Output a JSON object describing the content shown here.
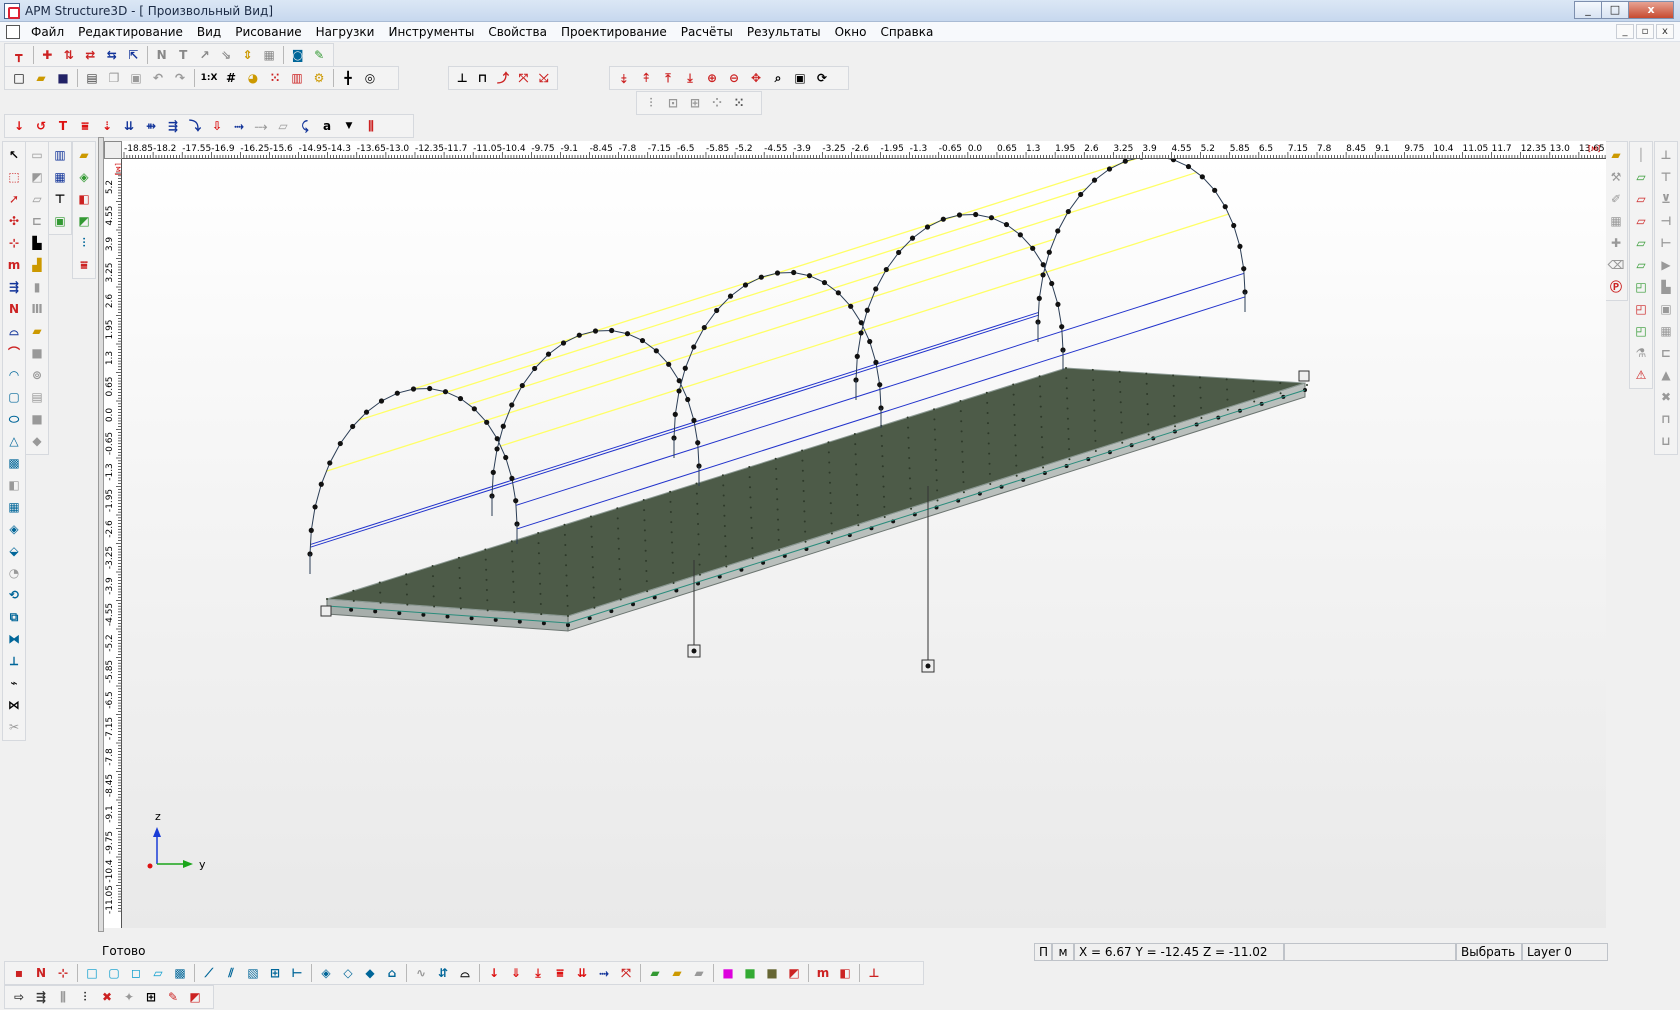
{
  "window": {
    "title": "APM Structure3D - [ Произвольный Вид]",
    "minimize_label": "_",
    "maximize_label": "□",
    "close_label": "x"
  },
  "menu": {
    "items": [
      "Файл",
      "Редактирование",
      "Вид",
      "Рисование",
      "Нагрузки",
      "Инструменты",
      "Свойства",
      "Проектирование",
      "Расчёты",
      "Результаты",
      "Окно",
      "Справка"
    ],
    "mdi_minimize": "_",
    "mdi_restore": "▫",
    "mdi_close": "x"
  },
  "rulers": {
    "horizontal_ticks": [
      "-18.85",
      "-18.2",
      "-17.55",
      "-16.9",
      "-16.25",
      "-15.6",
      "-14.95",
      "-14.3",
      "-13.65",
      "-13.0",
      "-12.35",
      "-11.7",
      "-11.05",
      "-10.4",
      "-9.75",
      "-9.1",
      "-8.45",
      "-7.8",
      "-7.15",
      "-6.5",
      "-5.85",
      "-5.2",
      "-4.55",
      "-3.9",
      "-3.25",
      "-2.6",
      "-1.95",
      "-1.3",
      "-0.65",
      "0.0",
      "0.65",
      "1.3",
      "1.95",
      "2.6",
      "3.25",
      "3.9",
      "4.55",
      "5.2",
      "5.85",
      "6.5",
      "7.15",
      "7.8",
      "8.45",
      "9.1",
      "9.75",
      "10.4",
      "11.05",
      "11.7",
      "12.35",
      "13.0",
      "13.65"
    ],
    "horizontal_unit": "[м]",
    "vertical_ticks": [
      "5.2",
      "4.55",
      "3.9",
      "3.25",
      "2.6",
      "1.95",
      "1.3",
      "0.65",
      "0.0",
      "-0.65",
      "-1.3",
      "-1.95",
      "-2.6",
      "-3.25",
      "-3.9",
      "-4.55",
      "-5.2",
      "-5.85",
      "-6.5",
      "-7.15",
      "-7.8",
      "-8.45",
      "-9.1",
      "-9.75",
      "-10.4",
      "-11.05"
    ],
    "vertical_unit": "[м]"
  },
  "axes": {
    "z": "z",
    "y": "y"
  },
  "status": {
    "ready": "Готово",
    "p": "П",
    "m": "м",
    "coords": "X = 6.67 Y = -12.45 Z = -11.02",
    "mode": "Выбрать",
    "layer": "Layer 0"
  },
  "toolbar_text": {
    "n_label": "N",
    "t_label": "T",
    "scale_label": "1:X",
    "m_label": "m",
    "a_label": "a"
  },
  "colors": {
    "deck": "#4a5a45",
    "deck_edge": "#9aa4a0",
    "arch": "#2b3d55",
    "yellow_line": "#ffff66",
    "blue_line": "#2233cc",
    "node": "#111111"
  }
}
